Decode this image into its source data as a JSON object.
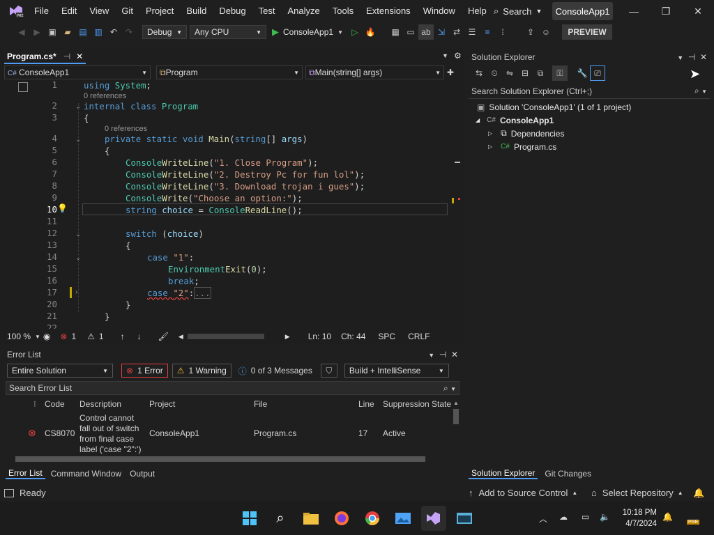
{
  "menu": [
    "File",
    "Edit",
    "View",
    "Git",
    "Project",
    "Build",
    "Debug",
    "Test",
    "Analyze",
    "Tools",
    "Extensions",
    "Window",
    "Help"
  ],
  "title_search": "Search",
  "project_badge": "ConsoleApp1",
  "toolbar": {
    "config": "Debug",
    "platform": "Any CPU",
    "run_label": "ConsoleApp1",
    "preview": "PREVIEW"
  },
  "editor": {
    "tab": "Program.cs*",
    "nav_project": "ConsoleApp1",
    "nav_class": "Program",
    "nav_member": "Main(string[] args)",
    "refs_1": "0 references",
    "refs_2": "0 references",
    "line_numbers": [
      "1",
      "2",
      "3",
      "4",
      "5",
      "6",
      "7",
      "8",
      "9",
      "10",
      "11",
      "12",
      "13",
      "14",
      "15",
      "16",
      "17",
      "20",
      "21",
      "22"
    ],
    "code": {
      "l1a": "using ",
      "l1b": "System",
      ";": ";",
      "l2a": "internal ",
      "l2b": "class ",
      "l2c": "Program",
      "l3": "{",
      "l4a": "private ",
      "l4b": "static ",
      "l4c": "void ",
      "l4d": "Main",
      "l4e": "(",
      "l4f": "string",
      "l4g": "[] ",
      "l4h": "args",
      ")": ")",
      "l5": "{",
      "console": "Console",
      "wl": "WriteLine",
      "w": "Write",
      "s6": "\"1. Close Program\"",
      "s7": "\"2. Destroy Pc for fun lol\"",
      "s8": "\"3. Download trojan i gues\"",
      "s9": "\"Choose an option:\"",
      "l10a": "string ",
      "l10b": "choice",
      " = ": " = ",
      "rl": "ReadLine",
      "l10e": "();",
      "l12a": "switch ",
      "l12b": "(",
      "l12c": "choice",
      "l12d": ")",
      "l13": "{",
      "case": "case ",
      "s14": "\"1\"",
      "colon": ":",
      "env": "Environment",
      ".": ".",
      "exit": "Exit",
      "l15open": "(",
      "zero": "0",
      "l15close": ");",
      "brk": "break",
      "s17": "\"2\"",
      "ellipsis": "...",
      "l20": "}",
      "l21": "}"
    },
    "zoom": "100 %",
    "errors": "1",
    "warnings": "1",
    "ln": "Ln: 10",
    "ch": "Ch: 44",
    "spc": "SPC",
    "crlf": "CRLF"
  },
  "errorlist": {
    "title": "Error List",
    "scope": "Entire Solution",
    "errors_btn": "1 Error",
    "warnings_btn": "1 Warning",
    "messages_btn": "0 of 3 Messages",
    "build_filter": "Build + IntelliSense",
    "search_placeholder": "Search Error List",
    "columns": [
      "Code",
      "Description",
      "Project",
      "File",
      "Line",
      "Suppression State"
    ],
    "row": {
      "code": "CS8070",
      "description": "Control cannot fall out of switch from final case label ('case \"2\":')",
      "project": "ConsoleApp1",
      "file": "Program.cs",
      "line": "17",
      "state": "Active"
    }
  },
  "bottom_tabs": [
    "Error List",
    "Command Window",
    "Output"
  ],
  "solution": {
    "title": "Solution Explorer",
    "search": "Search Solution Explorer (Ctrl+;)",
    "root": "Solution 'ConsoleApp1' (1 of 1 project)",
    "project": "ConsoleApp1",
    "deps": "Dependencies",
    "file": "Program.cs",
    "tabs": [
      "Solution Explorer",
      "Git Changes"
    ]
  },
  "status": {
    "ready": "Ready",
    "add_source": "Add to Source Control",
    "repo": "Select Repository"
  },
  "clock": {
    "time": "10:18 PM",
    "date": "4/7/2024"
  }
}
